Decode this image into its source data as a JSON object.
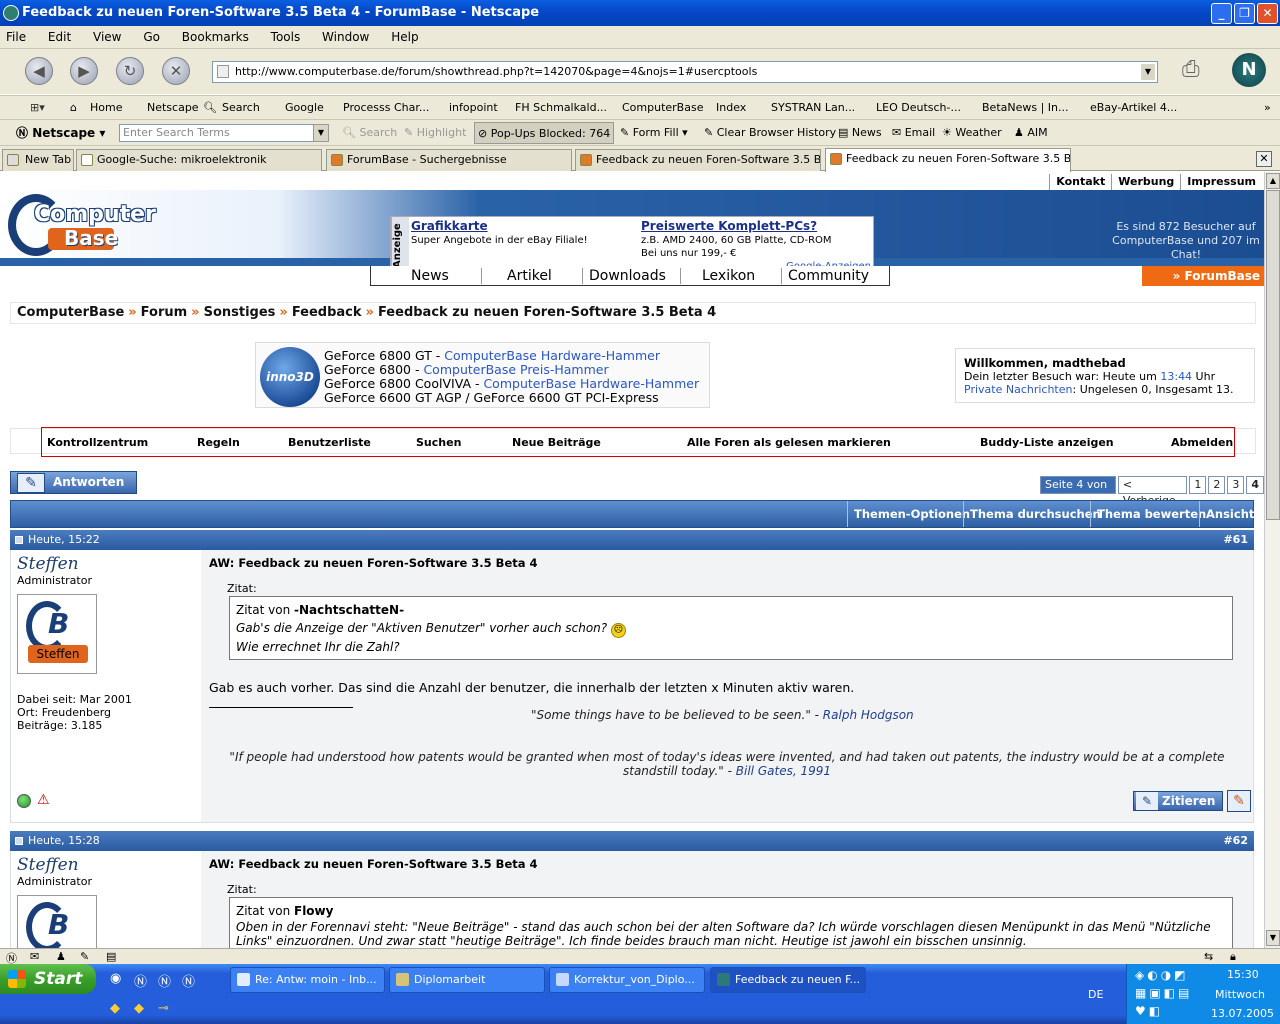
{
  "window": {
    "title": "Feedback zu neuen Foren-Software 3.5 Beta 4 - ForumBase - Netscape"
  },
  "menu": [
    "File",
    "Edit",
    "View",
    "Go",
    "Bookmarks",
    "Tools",
    "Window",
    "Help"
  ],
  "address": {
    "url": "http://www.computerbase.de/forum/showthread.php?t=142070&page=4&nojs=1#usercptools"
  },
  "bookmarks": [
    "Home",
    "Netscape",
    "Search",
    "Google",
    "Processs Char...",
    "infopoint",
    "FH Schmalkald...",
    "ComputerBase",
    "Index",
    "SYSTRAN Lan...",
    "LEO Deutsch-...",
    "BetaNews | In...",
    "eBay-Artikel 4..."
  ],
  "searchbar": {
    "brand": "Netscape",
    "placeholder": "Enter Search Terms",
    "search": "Search",
    "highlight": "Highlight",
    "popups": "Pop-Ups Blocked: 764",
    "formfill": "Form Fill",
    "clear": "Clear Browser History",
    "news": "News",
    "email": "Email",
    "weather": "Weather",
    "aim": "AIM"
  },
  "tabs": [
    "New Tab",
    "Google-Suche: mikroelektronik",
    "ForumBase - Suchergebnisse",
    "Feedback zu neuen Foren-Software 3.5 Be...",
    "Feedback zu neuen Foren-Software 3.5 Be..."
  ],
  "site": {
    "toplinks": [
      "Kontakt",
      "Werbung",
      "Impressum"
    ],
    "logo_top": "Computer",
    "logo_bottom": "Base",
    "ads": {
      "label": "Anzeige",
      "ad1_title": "Grafikkarte",
      "ad1_text": "Super Angebote in der eBay Filiale!",
      "ad2_title": "Preiswerte Komplett-PCs?",
      "ad2_line1": "z.B. AMD 2400, 60 GB Platte, CD-ROM",
      "ad2_line2": "Bei uns nur 199,- €",
      "google": "Google-Anzeigen"
    },
    "visitors": "Es sind 872 Besucher auf ComputerBase und 207 im Chat!",
    "nav": [
      "News",
      "Artikel",
      "Downloads",
      "Lexikon",
      "Community"
    ],
    "forumbase": "» ForumBase",
    "breadcrumb": [
      "ComputerBase",
      "Forum",
      "Sonstiges",
      "Feedback",
      "Feedback zu neuen Foren-Software 3.5 Beta 4"
    ],
    "promo": {
      "brand": "inno3D",
      "l1a": "GeForce 6800 GT - ",
      "l1b": "ComputerBase Hardware-Hammer",
      "l2a": "GeForce 6800 - ",
      "l2b": "ComputerBase Preis-Hammer",
      "l3a": "GeForce 6800 CoolVIVA - ",
      "l3b": "ComputerBase Hardware-Hammer",
      "l4": "GeForce 6600 GT AGP / GeForce 6600 GT PCI-Express"
    },
    "welcome": {
      "title": "Willkommen, madthebad",
      "visit_pre": "Dein letzter Besuch war: Heute um ",
      "visit_time": "13:44",
      "visit_post": " Uhr",
      "pm_link": "Private Nachrichten",
      "pm_text": ": Ungelesen 0, Insgesamt 13."
    },
    "usermenu": [
      "Kontrollzentrum",
      "Regeln",
      "Benutzerliste",
      "Suchen",
      "Neue Beiträge",
      "Alle Foren als gelesen markieren",
      "Buddy-Liste anzeigen",
      "Abmelden"
    ],
    "reply": "Antworten",
    "pager": {
      "label": "Seite 4 von 4",
      "prev": "< Vorherige",
      "pages": [
        "1",
        "2",
        "3",
        "4"
      ]
    },
    "threadbar": [
      "Themen-Optionen",
      "Thema durchsuchen",
      "Thema bewerten",
      "Ansicht"
    ]
  },
  "posts": [
    {
      "date": "Heute, 15:22",
      "num": "#61",
      "user": "Steffen",
      "role": "Administrator",
      "avatar_text": "Steffen",
      "joined": "Dabei seit: Mar 2001",
      "location": "Ort: Freudenberg",
      "posts": "Beiträge: 3.185",
      "title": "AW: Feedback zu neuen Foren-Software 3.5 Beta 4",
      "zitat": "Zitat:",
      "quote_pre": "Zitat von ",
      "quote_author": "-NachtschatteN-",
      "quote_l1": "Gab's die Anzeige der \"Aktiven Benutzer\" vorher auch schon?",
      "quote_l2": "Wie errechnet Ihr die Zahl?",
      "text": "Gab es auch vorher. Das sind die Anzahl der benutzer, die innerhalb der letzten x Minuten aktiv waren.",
      "sig1_a": "\"Some things have to be believed to be seen.\" - ",
      "sig1_b": "Ralph Hodgson",
      "sig2_a": "\"If people had understood how patents would be granted when most of today's ideas were invented, and had taken out patents, the industry would be at a complete standstill today.\" - ",
      "sig2_b": "Bill Gates, 1991",
      "quote_btn": "Zitieren"
    },
    {
      "date": "Heute, 15:28",
      "num": "#62",
      "user": "Steffen",
      "role": "Administrator",
      "title": "AW: Feedback zu neuen Foren-Software 3.5 Beta 4",
      "zitat": "Zitat:",
      "quote_pre": "Zitat von ",
      "quote_author": "Flowy",
      "quote_l1": "Oben in der Forennavi steht: \"Neue Beiträge\" - stand das auch schon bei der alten Software da? Ich würde vorschlagen diesen Menüpunkt in das Menü \"Nützliche",
      "quote_l2": "Links\" einzuordnen. Und zwar statt \"heutige Beiträge\". Ich finde beides brauch man nicht. Heutige ist jawohl ein bisschen unsinnig."
    }
  ],
  "taskbar": {
    "start": "Start",
    "tasks": [
      "Re: Antw: moin - Inb...",
      "Diplomarbeit",
      "Korrektur_von_Diplo...",
      "Feedback zu neuen F..."
    ],
    "lang": "DE",
    "time": "15:30",
    "day": "Mittwoch",
    "date": "13.07.2005"
  }
}
